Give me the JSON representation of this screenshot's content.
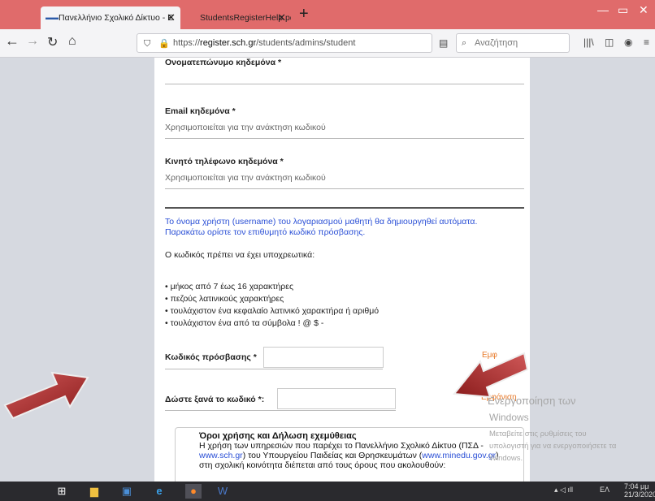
{
  "browser": {
    "tabs": [
      {
        "title": "Πανελλήνιο Σχολικό Δίκτυο - Ε",
        "favicon": "psd-logo",
        "active": true
      },
      {
        "title": "StudentsRegisterHelp.pdf",
        "active": false
      }
    ],
    "url": {
      "scheme": "https://",
      "domain": "register.sch.gr",
      "path": "/students/admins/student"
    },
    "search_placeholder": "Αναζήτηση",
    "accent_color": "#e06b6b"
  },
  "form": {
    "guardian_name_label": "Ονοματεπώνυμο κηδεμόνα *",
    "guardian_email_label": "Email κηδεμόνα *",
    "guardian_email_hint": "Χρησιμοποιείται για την ανάκτηση κωδικού",
    "guardian_phone_label": "Κινητό τηλέφωνο κηδεμόνα *",
    "guardian_phone_hint": "Χρησιμοποιείται για την ανάκτηση κωδικού",
    "info_line1": "Το όνομα χρήστη (username) του λογαριασμού μαθητή θα δημιουργηθεί αυτόματα.",
    "info_line2": "Παρακάτω ορίστε τον επιθυμητό κωδικό πρόσβασης.",
    "requirements_intro": "Ο κωδικός πρέπει να έχει υποχρεωτικά:",
    "requirements": [
      "μήκος από 7 έως 16 χαρακτήρες",
      "πεζούς λατινικούς χαρακτήρες",
      "τουλάχιστον ένα κεφαλαίο λατινικό χαρακτήρα ή αριθμό",
      "τουλάχιστον ένα από τα σύμβολα ! @ $ -"
    ],
    "password_label": "Κωδικός πρόσβασης *",
    "password_value": "",
    "password_side_text": "Εμφ",
    "confirm_label": "Δώστε ξανά το κωδικό *:",
    "confirm_value": "",
    "confirm_side_text": "Εμφάνιση"
  },
  "terms": {
    "title": "Όροι χρήσης και Δήλωση εχεμύθειας",
    "line1": "Η χρήση των υπηρεσιών που παρέχει το Πανελλήνιο Σχολικό Δίκτυο (ΠΣΔ -",
    "link1": "www.sch.gr",
    "line2": ") του Υπουργείου Παιδείας και Θρησκευμάτων (",
    "link2": "www.minedu.gov.gr",
    "line3": ")",
    "line4": "στη σχολική κοινότητα διέπεται από τους όρους που ακολουθούν:"
  },
  "watermark": {
    "title": "Ενεργοποίηση των",
    "subtitle": "Windows",
    "line1": "Μεταβείτε στις ρυθμίσεις του",
    "line2": "υπολογιστή για να ενεργοποιήσετε τα",
    "line3": "Windows."
  },
  "taskbar": {
    "language": "ΕΛ",
    "time": "7:04 μμ",
    "date": "21/3/2020"
  }
}
